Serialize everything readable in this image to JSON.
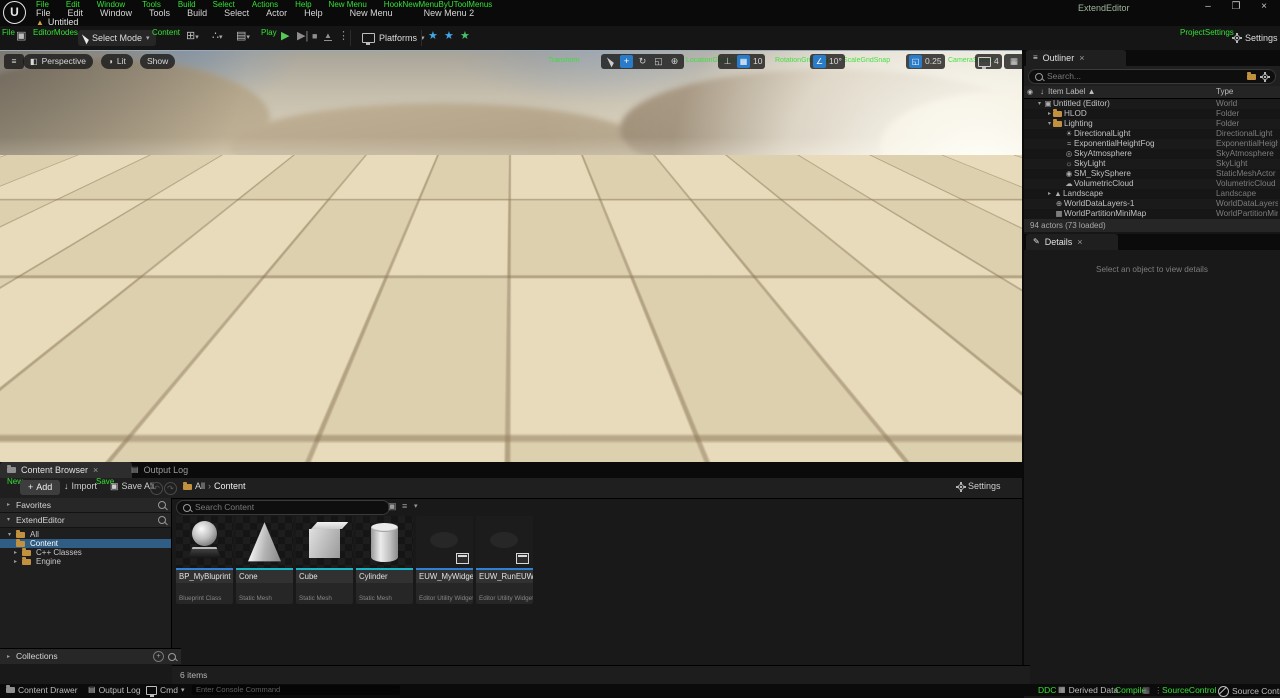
{
  "window": {
    "title": "ExtendEditor",
    "minimize": "–",
    "maximize": "❐",
    "close": "×"
  },
  "menubar": {
    "debug": [
      "File",
      "Edit",
      "Window",
      "Tools",
      "Build",
      "Select",
      "Actions",
      "Help",
      "New Menu",
      "HookNewMenuByUToolMenus"
    ],
    "items": [
      "File",
      "Edit",
      "Window",
      "Tools",
      "Build",
      "Select",
      "Actor",
      "Help",
      "New Menu",
      "New Menu 2"
    ],
    "level_name": "Untitled"
  },
  "toolbar": {
    "debug_file": "File",
    "debug_modes": "EditorModes",
    "debug_content": "Content",
    "debug_play": "Play",
    "debug_settings": "ProjectSettings",
    "select_mode": "Select Mode",
    "platforms": "Platforms",
    "settings": "Settings"
  },
  "viewport": {
    "pills": [
      "Perspective",
      "Lit",
      "Show"
    ],
    "grid_snap": "10",
    "rotation_snap": "10°",
    "scale_snap": "0.25",
    "camera_speed": "4",
    "debug_labels": [
      "Transform",
      "LocationGridSnap",
      "RotationGridSnap",
      "ScaleGridSnap",
      "CameraSpeed"
    ]
  },
  "outliner": {
    "tab": "Outliner",
    "search_placeholder": "Search...",
    "col_label": "Item Label ▲",
    "col_type": "Type",
    "rows": [
      {
        "label": "Untitled (Editor)",
        "type": "World"
      },
      {
        "label": "HLOD",
        "type": "Folder"
      },
      {
        "label": "Lighting",
        "type": "Folder"
      },
      {
        "label": "DirectionalLight",
        "type": "DirectionalLight"
      },
      {
        "label": "ExponentialHeightFog",
        "type": "ExponentialHeightFog"
      },
      {
        "label": "SkyAtmosphere",
        "type": "SkyAtmosphere"
      },
      {
        "label": "SkyLight",
        "type": "SkyLight"
      },
      {
        "label": "SM_SkySphere",
        "type": "StaticMeshActor"
      },
      {
        "label": "VolumetricCloud",
        "type": "VolumetricCloud"
      },
      {
        "label": "Landscape",
        "type": "Landscape"
      },
      {
        "label": "WorldDataLayers-1",
        "type": "WorldDataLayers"
      },
      {
        "label": "WorldPartitionMiniMap",
        "type": "WorldPartitionMiniMap"
      }
    ],
    "footer": "94 actors (73 loaded)"
  },
  "details": {
    "tab": "Details",
    "empty_text": "Select an object to view details"
  },
  "content_browser": {
    "tab_content": "Content Browser",
    "tab_output": "Output Log",
    "debug_new": "New",
    "debug_save": "Save",
    "add": "Add",
    "import": "Import",
    "save_all": "Save All",
    "crumb_root": "All",
    "crumb_current": "Content",
    "settings": "Settings",
    "search_placeholder": "Search Content",
    "favorites": "Favorites",
    "project": "ExtendEditor",
    "tree": {
      "all": "All",
      "content": "Content",
      "cpp": "C++ Classes",
      "engine": "Engine"
    },
    "collections": "Collections",
    "assets": [
      {
        "name": "BP_MyBluprint",
        "type": "Blueprint Class",
        "accent": "#2d81d6"
      },
      {
        "name": "Cone",
        "type": "Static Mesh",
        "accent": "#18b5c8"
      },
      {
        "name": "Cube",
        "type": "Static Mesh",
        "accent": "#18b5c8"
      },
      {
        "name": "Cylinder",
        "type": "Static Mesh",
        "accent": "#18b5c8"
      },
      {
        "name": "EUW_MyWidget",
        "type": "Editor Utility Widget",
        "accent": "#2d81d6"
      },
      {
        "name": "EUW_RunEUW",
        "type": "Editor Utility Widget",
        "accent": "#2d81d6"
      }
    ],
    "items_count": "6 items"
  },
  "status_bar": {
    "content_drawer": "Content Drawer",
    "output_log": "Output Log",
    "cmd": "Cmd",
    "console_placeholder": "Enter Console Command",
    "debug_ddc": "DDC",
    "derived_data": "Derived Data",
    "debug_compile": "Compile",
    "debug_source_control": "SourceControl",
    "source_control": "Source Control Off"
  },
  "colors": {
    "debug_green": "#35e035",
    "accent_blue": "#2a7cc9",
    "selection_blue": "#2f5d83",
    "static_mesh_accent": "#18b5c8",
    "blueprint_accent": "#2d81d6"
  }
}
